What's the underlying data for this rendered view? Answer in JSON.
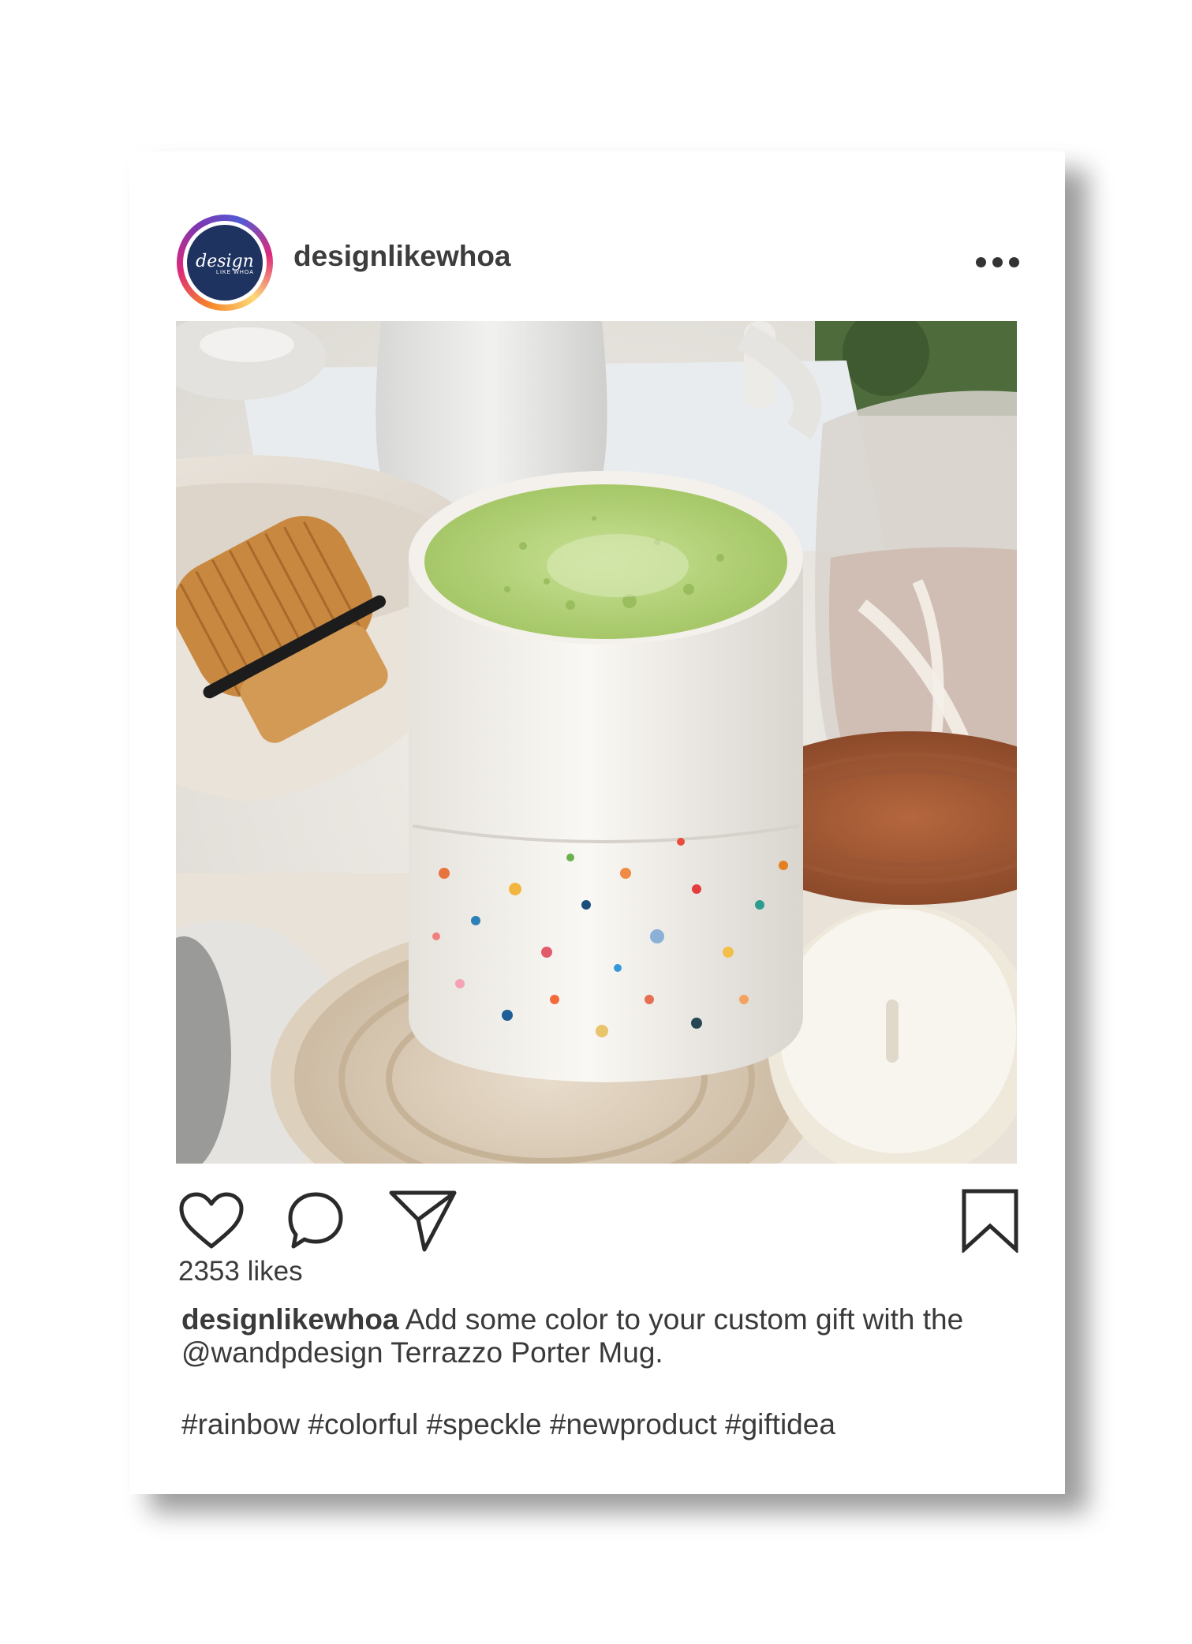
{
  "post": {
    "username": "designlikewhoa",
    "avatar_logo_main": "design",
    "avatar_logo_sub": "LIKE WHOA",
    "likes_text": "2353 likes",
    "caption_user": "designlikewhoa",
    "caption_text": " Add some color to your custom gift with the @wandpdesign Terrazzo Porter Mug.",
    "hashtags": "#rainbow #colorful #speckle #newproduct #giftidea"
  },
  "icons": {
    "more": "more-horizontal-icon",
    "like": "heart-icon",
    "comment": "comment-bubble-icon",
    "share": "paper-plane-icon",
    "save": "bookmark-icon"
  },
  "colors": {
    "text": "#3a3a3a",
    "avatar_bg": "#1f3361",
    "matcha": "#b7d77b"
  }
}
